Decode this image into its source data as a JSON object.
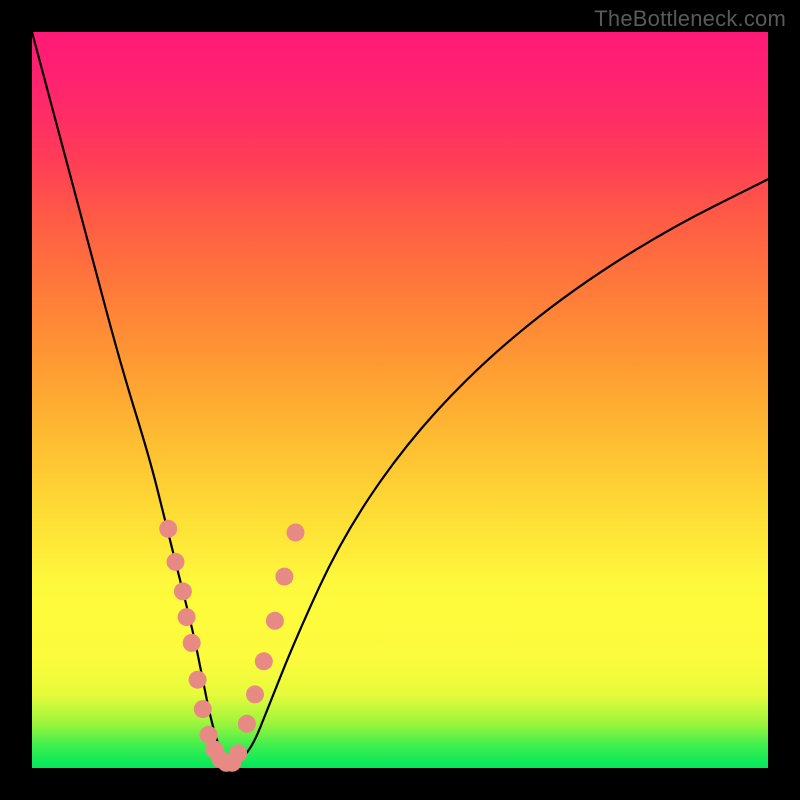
{
  "watermark": "TheBottleneck.com",
  "colors": {
    "frame": "#000000",
    "curve": "#000000",
    "dots": "#e78a84",
    "gradient_stops": [
      "#00e85b",
      "#fdfb3d",
      "#ff7a3a",
      "#ff1a77"
    ]
  },
  "chart_data": {
    "type": "line",
    "title": "",
    "xlabel": "",
    "ylabel": "",
    "xlim": [
      0,
      100
    ],
    "ylim": [
      0,
      100
    ],
    "note": "x/y given in percent of the plot area (origin at top-left of the gradient box). Curve is a V-shaped bottleneck curve.",
    "series": [
      {
        "name": "bottleneck-curve",
        "x": [
          0,
          4,
          8,
          12,
          16,
          18,
          20,
          22,
          23,
          24,
          25,
          26,
          27,
          28,
          30,
          32,
          36,
          42,
          50,
          60,
          72,
          86,
          100
        ],
        "y": [
          0,
          15,
          30,
          45,
          58,
          66,
          74,
          82,
          87,
          92,
          96,
          98.5,
          99.3,
          99.3,
          97,
          92,
          82,
          69,
          57,
          46,
          36,
          27,
          20
        ]
      }
    ],
    "scatter_overlay": {
      "name": "data-points",
      "x": [
        18.5,
        19.5,
        20.5,
        21.0,
        21.7,
        22.5,
        23.2,
        24.0,
        24.8,
        25.6,
        26.4,
        27.2,
        28.0,
        29.2,
        30.3,
        31.5,
        33.0,
        34.3,
        35.8
      ],
      "y": [
        67.5,
        72.0,
        76.0,
        79.5,
        83.0,
        88.0,
        92.0,
        95.5,
        97.5,
        98.8,
        99.3,
        99.3,
        98.0,
        94.0,
        90.0,
        85.5,
        80.0,
        74.0,
        68.0
      ]
    }
  }
}
